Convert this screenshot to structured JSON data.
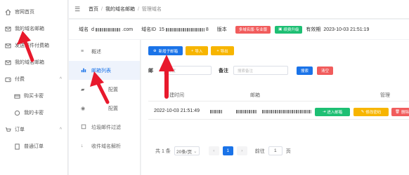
{
  "sidebar": {
    "items": [
      {
        "label": "官网首页",
        "icon": "home-icon"
      },
      {
        "label": "我的域名邮箱",
        "icon": "mail-icon"
      },
      {
        "label": "发送邮件付费箱",
        "icon": "mail-icon"
      },
      {
        "label": "我的域名邮箱",
        "icon": "mail-icon"
      },
      {
        "label": "付费",
        "icon": "wallet-icon"
      },
      {
        "label": "购买卡密",
        "icon": "card-icon"
      },
      {
        "label": "我的卡密",
        "icon": "card-icon"
      },
      {
        "label": "订单",
        "icon": "order-icon"
      },
      {
        "label": "普通订单",
        "icon": "order-icon"
      }
    ]
  },
  "breadcrumb": {
    "home": "首页",
    "mid": "我的域名邮箱",
    "last": "管理域名",
    "sep": "/"
  },
  "infobar": {
    "domain_label": "域名",
    "domain_suffix": ".com",
    "domain_id_label": "域名ID",
    "domain_id_prefix": "15",
    "domain_id_suffix": "8",
    "version_label": "版本",
    "version_button": "多域名版·专业版",
    "upgrade_button": "续费升级",
    "expiry_label": "有效期",
    "expiry_value": "2023-10-03 21:51:19"
  },
  "submenu": {
    "items": [
      {
        "label": "概述",
        "icon": "list-icon"
      },
      {
        "label": "邮箱列表",
        "icon": "bar-chart-icon"
      },
      {
        "label": "配置",
        "icon": "settings-icon"
      },
      {
        "label": "配置",
        "icon": "location-icon"
      },
      {
        "label": "垃圾邮件过滤",
        "icon": "filter-icon"
      },
      {
        "label": "收件域名解析",
        "icon": "download-icon"
      }
    ]
  },
  "toolbar": {
    "add_label": "新增子邮箱",
    "import_label": "导入",
    "export_label": "导出"
  },
  "search": {
    "field_label": "邮",
    "field_placeholder": "配置",
    "remark_label": "备注",
    "remark_placeholder": "搜索备注",
    "search_button": "搜索",
    "clear_button": "清空"
  },
  "table": {
    "headers": [
      "建时间",
      "邮箱",
      "管理"
    ],
    "rows": [
      {
        "created": "2022-10-03 21:51:49",
        "enter_label": "进入邮箱",
        "edit_label": "修改密码",
        "delete_label": "删除"
      }
    ]
  },
  "pager": {
    "total": "共 1 条",
    "page_size": "20条/页",
    "prev": "‹",
    "current": "1",
    "next": "›",
    "goto_label": "前往",
    "goto_value": "1",
    "page_unit": "页"
  },
  "colors": {
    "accent": "#1a73e8",
    "red": "#f15c5c",
    "green": "#1dbf73",
    "orange": "#f7b500",
    "arrow": "#e8192c"
  }
}
